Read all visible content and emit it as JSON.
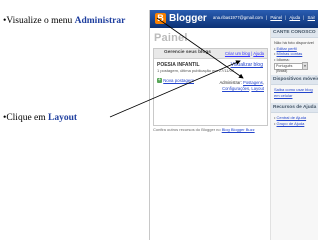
{
  "slide": {
    "bullet1_prefix": "•Visualize o menu ",
    "bullet1_highlight": "Administrar",
    "bullet2_prefix": "•Clique em ",
    "bullet2_highlight": "Layout"
  },
  "blogger": {
    "logo_letter": "B",
    "brand": "Blogger",
    "user_email": "ana.ribas1977@gmail.com",
    "top_links": [
      "Painel",
      "Ajuda",
      "Sair"
    ],
    "page_title": "Painel",
    "panel": {
      "header_label": "Gerencie seus blogs",
      "header_links": [
        "Criar um blog",
        "Ajuda"
      ],
      "blog_title": "POESIA INFANTIL",
      "blog_meta": "1 postagem, última publicação em 27/11/07",
      "view_blog": "Visualizar blog",
      "new_post": "Nova postagem",
      "admin_label": "Administrar:",
      "admin_links": [
        "Postagens",
        "Configurações",
        "Layout"
      ]
    },
    "footer_note_prefix": "Confira outros recursos do Blogger no ",
    "footer_note_link": "Blog Blogger Buzz",
    "right": {
      "profile_head": "CANTE CONOSCO",
      "profile_text": "Não há foto disponível",
      "profile_links": [
        "Editar perfil",
        "Minhas contas"
      ],
      "language_label": "Idioma:",
      "language_value": "Português (Brasil)",
      "devices_head": "Dispositivos móveis",
      "devices_text": "Saiba como usar blog em celular",
      "help_head": "Recursos de Ajuda",
      "help_links": [
        "Central de Ajuda",
        "Grupo de Ajuda"
      ]
    }
  },
  "colors": {
    "highlight": "#1f3f9f",
    "topbar": "#0c3275",
    "arrow": "#000000"
  }
}
